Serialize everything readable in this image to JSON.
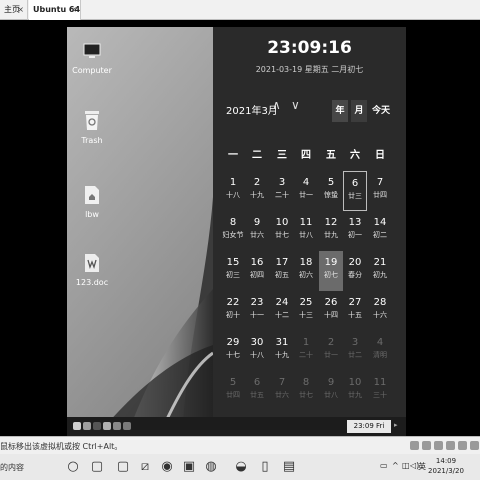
{
  "host_tabs": {
    "home": {
      "label": "主页",
      "close": "×"
    },
    "vm": {
      "label": "Ubuntu 64 位",
      "close": "×"
    }
  },
  "desktop_icons": [
    {
      "name": "computer",
      "label": "Computer"
    },
    {
      "name": "trash",
      "label": "Trash"
    },
    {
      "name": "home-folder",
      "label": "lbw"
    },
    {
      "name": "document",
      "label": "123.doc"
    }
  ],
  "calendar": {
    "clock": "23:09:16",
    "date_line": "2021-03-19 星期五 二月初七",
    "month": "2021年3月",
    "nav_prev": "∧",
    "nav_next": "∨",
    "view_year": "年",
    "view_month": "月",
    "view_today": "今天",
    "weekdays": [
      "一",
      "二",
      "三",
      "四",
      "五",
      "六",
      "日"
    ],
    "days": [
      {
        "d": "1",
        "l": "十八"
      },
      {
        "d": "2",
        "l": "十九"
      },
      {
        "d": "3",
        "l": "二十"
      },
      {
        "d": "4",
        "l": "廿一"
      },
      {
        "d": "5",
        "l": "惊蛰"
      },
      {
        "d": "6",
        "l": "廿三",
        "state": "today"
      },
      {
        "d": "7",
        "l": "廿四"
      },
      {
        "d": "8",
        "l": "妇女节"
      },
      {
        "d": "9",
        "l": "廿六"
      },
      {
        "d": "10",
        "l": "廿七"
      },
      {
        "d": "11",
        "l": "廿八"
      },
      {
        "d": "12",
        "l": "廿九"
      },
      {
        "d": "13",
        "l": "初一"
      },
      {
        "d": "14",
        "l": "初二"
      },
      {
        "d": "15",
        "l": "初三"
      },
      {
        "d": "16",
        "l": "初四"
      },
      {
        "d": "17",
        "l": "初五"
      },
      {
        "d": "18",
        "l": "初六"
      },
      {
        "d": "19",
        "l": "初七",
        "state": "selected"
      },
      {
        "d": "20",
        "l": "春分"
      },
      {
        "d": "21",
        "l": "初九"
      },
      {
        "d": "22",
        "l": "初十"
      },
      {
        "d": "23",
        "l": "十一"
      },
      {
        "d": "24",
        "l": "十二"
      },
      {
        "d": "25",
        "l": "十三"
      },
      {
        "d": "26",
        "l": "十四"
      },
      {
        "d": "27",
        "l": "十五"
      },
      {
        "d": "28",
        "l": "十六"
      },
      {
        "d": "29",
        "l": "十七"
      },
      {
        "d": "30",
        "l": "十八"
      },
      {
        "d": "31",
        "l": "十九"
      },
      {
        "d": "1",
        "l": "二十",
        "state": "dim"
      },
      {
        "d": "2",
        "l": "廿一",
        "state": "dim"
      },
      {
        "d": "3",
        "l": "廿二",
        "state": "dim"
      },
      {
        "d": "4",
        "l": "清明",
        "state": "dim"
      },
      {
        "d": "5",
        "l": "廿四",
        "state": "dim"
      },
      {
        "d": "6",
        "l": "廿五",
        "state": "dim"
      },
      {
        "d": "7",
        "l": "廿六",
        "state": "dim"
      },
      {
        "d": "8",
        "l": "廿七",
        "state": "dim"
      },
      {
        "d": "9",
        "l": "廿八",
        "state": "dim"
      },
      {
        "d": "10",
        "l": "廿九",
        "state": "dim"
      },
      {
        "d": "11",
        "l": "三十",
        "state": "dim"
      }
    ]
  },
  "guest_taskbar": {
    "icons": [
      "show-desktop-icon",
      "file-manager-icon",
      "terminal-icon",
      "browser-icon",
      "settings-icon",
      "app-icon"
    ],
    "clock": "23:09 Fri"
  },
  "host_status": {
    "hint": "鼠标移出该虚拟机或按 Ctrl+Alt。"
  },
  "host_taskbar": {
    "search_text": "的内容",
    "apps": [
      "task-view-icon",
      "app-icon",
      "pen-icon",
      "media-icon",
      "folder-icon",
      "app-icon",
      "browser-icon",
      "vmware-icon",
      "document-icon"
    ],
    "ime": "英",
    "time": "14:09",
    "date": "2021/3/20"
  }
}
